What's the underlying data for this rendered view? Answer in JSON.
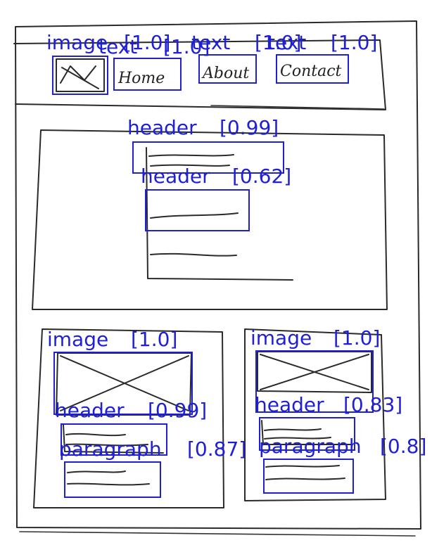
{
  "sketch_text": {
    "nav_home": "Home",
    "nav_about": "About",
    "nav_contact": "Contact"
  },
  "detections": [
    {
      "id": "det-nav-image",
      "label": "image",
      "score": "1.0"
    },
    {
      "id": "det-nav-home",
      "label": "text",
      "score": "1.0"
    },
    {
      "id": "det-nav-about",
      "label": "text",
      "score": "1.0"
    },
    {
      "id": "det-nav-contact",
      "label": "text",
      "score": "1.0"
    },
    {
      "id": "det-hero-header",
      "label": "header",
      "score": "0.99"
    },
    {
      "id": "det-hero-subheader",
      "label": "header",
      "score": "0.62"
    },
    {
      "id": "det-card1-image",
      "label": "image",
      "score": "1.0"
    },
    {
      "id": "det-card2-image",
      "label": "image",
      "score": "1.0"
    },
    {
      "id": "det-card1-header",
      "label": "header",
      "score": "0.99"
    },
    {
      "id": "det-card2-header",
      "label": "header",
      "score": "0.83"
    },
    {
      "id": "det-card1-paragraph",
      "label": "paragraph",
      "score": "0.87"
    },
    {
      "id": "det-card2-paragraph",
      "label": "paragraph",
      "score": "0.8"
    }
  ]
}
